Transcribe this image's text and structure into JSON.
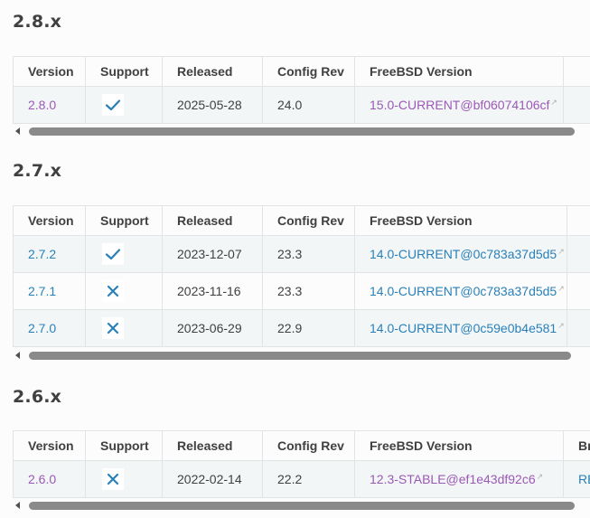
{
  "columns": {
    "version": "Version",
    "support": "Support",
    "released": "Released",
    "config_rev": "Config Rev",
    "freebsd_version": "FreeBSD Version",
    "partial_next": "Br"
  },
  "sections": [
    {
      "heading": "2.8.x",
      "rows": [
        {
          "version": "2.8.0",
          "supported": true,
          "released": "2025-05-28",
          "config_rev": "24.0",
          "freebsd": "15.0-CURRENT@bf06074106cf",
          "visited": true,
          "next": ""
        }
      ]
    },
    {
      "heading": "2.7.x",
      "rows": [
        {
          "version": "2.7.2",
          "supported": true,
          "released": "2023-12-07",
          "config_rev": "23.3",
          "freebsd": "14.0-CURRENT@0c783a37d5d5",
          "visited": false,
          "next": ""
        },
        {
          "version": "2.7.1",
          "supported": false,
          "released": "2023-11-16",
          "config_rev": "23.3",
          "freebsd": "14.0-CURRENT@0c783a37d5d5",
          "visited": false,
          "next": ""
        },
        {
          "version": "2.7.0",
          "supported": false,
          "released": "2023-06-29",
          "config_rev": "22.9",
          "freebsd": "14.0-CURRENT@0c59e0b4e581",
          "visited": false,
          "next": ""
        }
      ]
    },
    {
      "heading": "2.6.x",
      "rows": [
        {
          "version": "2.6.0",
          "supported": false,
          "released": "2022-02-14",
          "config_rev": "22.2",
          "freebsd": "12.3-STABLE@ef1e43df92c6",
          "visited": true,
          "next": "RE"
        }
      ]
    }
  ],
  "icons": {
    "supported": "check-icon",
    "unsupported": "x-icon",
    "external": "external-link-icon"
  },
  "colors": {
    "link": "#2980b9",
    "visited_link": "#9b59b6",
    "icon": "#2980b9",
    "row_odd": "#f3f6f6",
    "border": "#e1e4e5"
  }
}
